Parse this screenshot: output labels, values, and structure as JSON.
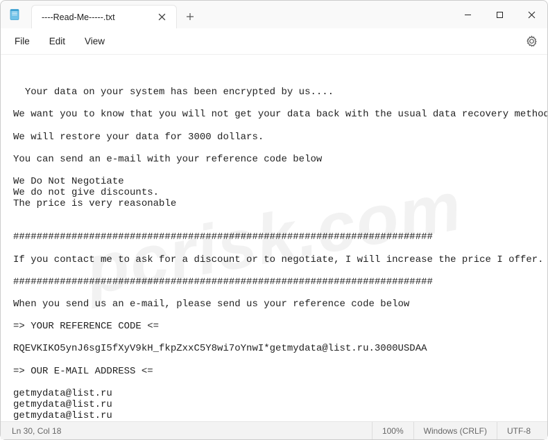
{
  "titlebar": {
    "tab_title": "----Read-Me-----.txt"
  },
  "menu": {
    "file": "File",
    "edit": "Edit",
    "view": "View"
  },
  "document": {
    "text": "Your data on your system has been encrypted by us....\n\nWe want you to know that you will not get your data back with the usual data recovery methods...\n\nWe will restore your data for 3000 dollars.\n\nYou can send an e-mail with your reference code below\n\nWe Do Not Negotiate\nWe do not give discounts.\nThe price is very reasonable\n\n\n########################################################################\n\nIf you contact me to ask for a discount or to negotiate, I will increase the price I offer.\n\n########################################################################\n\nWhen you send us an e-mail, please send us your reference code below\n\n=> YOUR REFERENCE CODE <=\n\nRQEVKIKO5ynJ6sgI5fXyV9kH_fkpZxxC5Y8wi7oYnwI*getmydata@list.ru.3000USDAA\n\n=> OUR E-MAIL ADDRESS <=\n\ngetmydata@list.ru\ngetmydata@list.ru\ngetmydata@list.ru"
  },
  "status": {
    "position": "Ln 30, Col 18",
    "zoom": "100%",
    "line_ending": "Windows (CRLF)",
    "encoding": "UTF-8"
  },
  "watermark": "pcrisk.com"
}
